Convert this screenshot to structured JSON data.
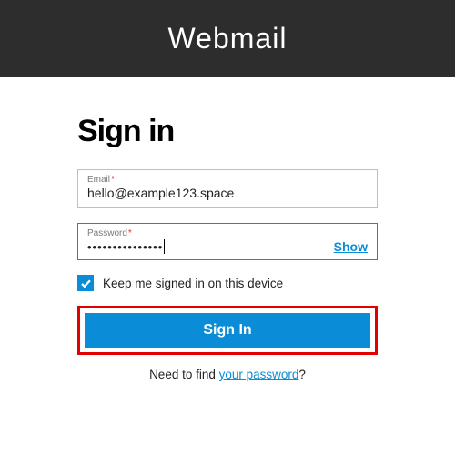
{
  "header": {
    "title": "Webmail"
  },
  "form": {
    "heading": "Sign in",
    "email": {
      "label": "Email",
      "required": "*",
      "value": "hello@example123.space"
    },
    "password": {
      "label": "Password",
      "required": "*",
      "masked": "•••••••••••••••",
      "show_label": "Show"
    },
    "keep_signed": {
      "label": "Keep me signed in on this device",
      "checked": true
    },
    "submit_label": "Sign In"
  },
  "footer": {
    "prefix": "Need to find ",
    "link_text": "your password",
    "suffix": "?"
  },
  "colors": {
    "accent": "#0a8dd6",
    "highlight_border": "#e30000",
    "header_bg": "#2d2d2d"
  }
}
